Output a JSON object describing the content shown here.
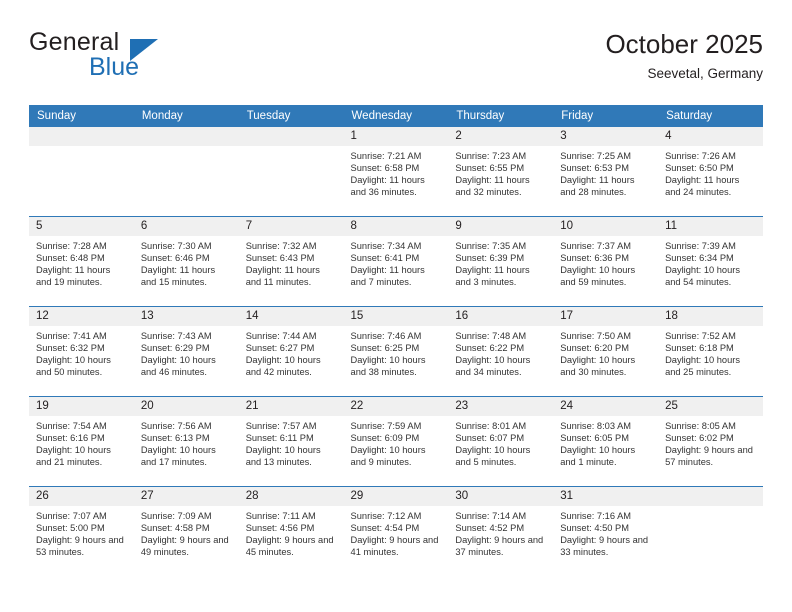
{
  "brand": {
    "name_part1": "General",
    "name_part2": "Blue",
    "flag_icon": "triangle-flag-icon"
  },
  "header": {
    "title": "October 2025",
    "subtitle": "Seevetal, Germany"
  },
  "theme": {
    "header_blue": "#3079b8",
    "brand_blue": "#1f6fb4",
    "daynum_band": "#f0f0f0",
    "text": "#231f20",
    "cell_text": "#333333"
  },
  "weekdays": [
    "Sunday",
    "Monday",
    "Tuesday",
    "Wednesday",
    "Thursday",
    "Friday",
    "Saturday"
  ],
  "weeks": [
    [
      {
        "day": "",
        "blank": true,
        "sunrise": "",
        "sunset": "",
        "daylight": ""
      },
      {
        "day": "",
        "blank": true,
        "sunrise": "",
        "sunset": "",
        "daylight": ""
      },
      {
        "day": "",
        "blank": true,
        "sunrise": "",
        "sunset": "",
        "daylight": ""
      },
      {
        "day": "1",
        "sunrise": "Sunrise: 7:21 AM",
        "sunset": "Sunset: 6:58 PM",
        "daylight": "Daylight: 11 hours and 36 minutes."
      },
      {
        "day": "2",
        "sunrise": "Sunrise: 7:23 AM",
        "sunset": "Sunset: 6:55 PM",
        "daylight": "Daylight: 11 hours and 32 minutes."
      },
      {
        "day": "3",
        "sunrise": "Sunrise: 7:25 AM",
        "sunset": "Sunset: 6:53 PM",
        "daylight": "Daylight: 11 hours and 28 minutes."
      },
      {
        "day": "4",
        "sunrise": "Sunrise: 7:26 AM",
        "sunset": "Sunset: 6:50 PM",
        "daylight": "Daylight: 11 hours and 24 minutes."
      }
    ],
    [
      {
        "day": "5",
        "sunrise": "Sunrise: 7:28 AM",
        "sunset": "Sunset: 6:48 PM",
        "daylight": "Daylight: 11 hours and 19 minutes."
      },
      {
        "day": "6",
        "sunrise": "Sunrise: 7:30 AM",
        "sunset": "Sunset: 6:46 PM",
        "daylight": "Daylight: 11 hours and 15 minutes."
      },
      {
        "day": "7",
        "sunrise": "Sunrise: 7:32 AM",
        "sunset": "Sunset: 6:43 PM",
        "daylight": "Daylight: 11 hours and 11 minutes."
      },
      {
        "day": "8",
        "sunrise": "Sunrise: 7:34 AM",
        "sunset": "Sunset: 6:41 PM",
        "daylight": "Daylight: 11 hours and 7 minutes."
      },
      {
        "day": "9",
        "sunrise": "Sunrise: 7:35 AM",
        "sunset": "Sunset: 6:39 PM",
        "daylight": "Daylight: 11 hours and 3 minutes."
      },
      {
        "day": "10",
        "sunrise": "Sunrise: 7:37 AM",
        "sunset": "Sunset: 6:36 PM",
        "daylight": "Daylight: 10 hours and 59 minutes."
      },
      {
        "day": "11",
        "sunrise": "Sunrise: 7:39 AM",
        "sunset": "Sunset: 6:34 PM",
        "daylight": "Daylight: 10 hours and 54 minutes."
      }
    ],
    [
      {
        "day": "12",
        "sunrise": "Sunrise: 7:41 AM",
        "sunset": "Sunset: 6:32 PM",
        "daylight": "Daylight: 10 hours and 50 minutes."
      },
      {
        "day": "13",
        "sunrise": "Sunrise: 7:43 AM",
        "sunset": "Sunset: 6:29 PM",
        "daylight": "Daylight: 10 hours and 46 minutes."
      },
      {
        "day": "14",
        "sunrise": "Sunrise: 7:44 AM",
        "sunset": "Sunset: 6:27 PM",
        "daylight": "Daylight: 10 hours and 42 minutes."
      },
      {
        "day": "15",
        "sunrise": "Sunrise: 7:46 AM",
        "sunset": "Sunset: 6:25 PM",
        "daylight": "Daylight: 10 hours and 38 minutes."
      },
      {
        "day": "16",
        "sunrise": "Sunrise: 7:48 AM",
        "sunset": "Sunset: 6:22 PM",
        "daylight": "Daylight: 10 hours and 34 minutes."
      },
      {
        "day": "17",
        "sunrise": "Sunrise: 7:50 AM",
        "sunset": "Sunset: 6:20 PM",
        "daylight": "Daylight: 10 hours and 30 minutes."
      },
      {
        "day": "18",
        "sunrise": "Sunrise: 7:52 AM",
        "sunset": "Sunset: 6:18 PM",
        "daylight": "Daylight: 10 hours and 25 minutes."
      }
    ],
    [
      {
        "day": "19",
        "sunrise": "Sunrise: 7:54 AM",
        "sunset": "Sunset: 6:16 PM",
        "daylight": "Daylight: 10 hours and 21 minutes."
      },
      {
        "day": "20",
        "sunrise": "Sunrise: 7:56 AM",
        "sunset": "Sunset: 6:13 PM",
        "daylight": "Daylight: 10 hours and 17 minutes."
      },
      {
        "day": "21",
        "sunrise": "Sunrise: 7:57 AM",
        "sunset": "Sunset: 6:11 PM",
        "daylight": "Daylight: 10 hours and 13 minutes."
      },
      {
        "day": "22",
        "sunrise": "Sunrise: 7:59 AM",
        "sunset": "Sunset: 6:09 PM",
        "daylight": "Daylight: 10 hours and 9 minutes."
      },
      {
        "day": "23",
        "sunrise": "Sunrise: 8:01 AM",
        "sunset": "Sunset: 6:07 PM",
        "daylight": "Daylight: 10 hours and 5 minutes."
      },
      {
        "day": "24",
        "sunrise": "Sunrise: 8:03 AM",
        "sunset": "Sunset: 6:05 PM",
        "daylight": "Daylight: 10 hours and 1 minute."
      },
      {
        "day": "25",
        "sunrise": "Sunrise: 8:05 AM",
        "sunset": "Sunset: 6:02 PM",
        "daylight": "Daylight: 9 hours and 57 minutes."
      }
    ],
    [
      {
        "day": "26",
        "sunrise": "Sunrise: 7:07 AM",
        "sunset": "Sunset: 5:00 PM",
        "daylight": "Daylight: 9 hours and 53 minutes."
      },
      {
        "day": "27",
        "sunrise": "Sunrise: 7:09 AM",
        "sunset": "Sunset: 4:58 PM",
        "daylight": "Daylight: 9 hours and 49 minutes."
      },
      {
        "day": "28",
        "sunrise": "Sunrise: 7:11 AM",
        "sunset": "Sunset: 4:56 PM",
        "daylight": "Daylight: 9 hours and 45 minutes."
      },
      {
        "day": "29",
        "sunrise": "Sunrise: 7:12 AM",
        "sunset": "Sunset: 4:54 PM",
        "daylight": "Daylight: 9 hours and 41 minutes."
      },
      {
        "day": "30",
        "sunrise": "Sunrise: 7:14 AM",
        "sunset": "Sunset: 4:52 PM",
        "daylight": "Daylight: 9 hours and 37 minutes."
      },
      {
        "day": "31",
        "sunrise": "Sunrise: 7:16 AM",
        "sunset": "Sunset: 4:50 PM",
        "daylight": "Daylight: 9 hours and 33 minutes."
      },
      {
        "day": "",
        "blank": true,
        "sunrise": "",
        "sunset": "",
        "daylight": ""
      }
    ]
  ]
}
